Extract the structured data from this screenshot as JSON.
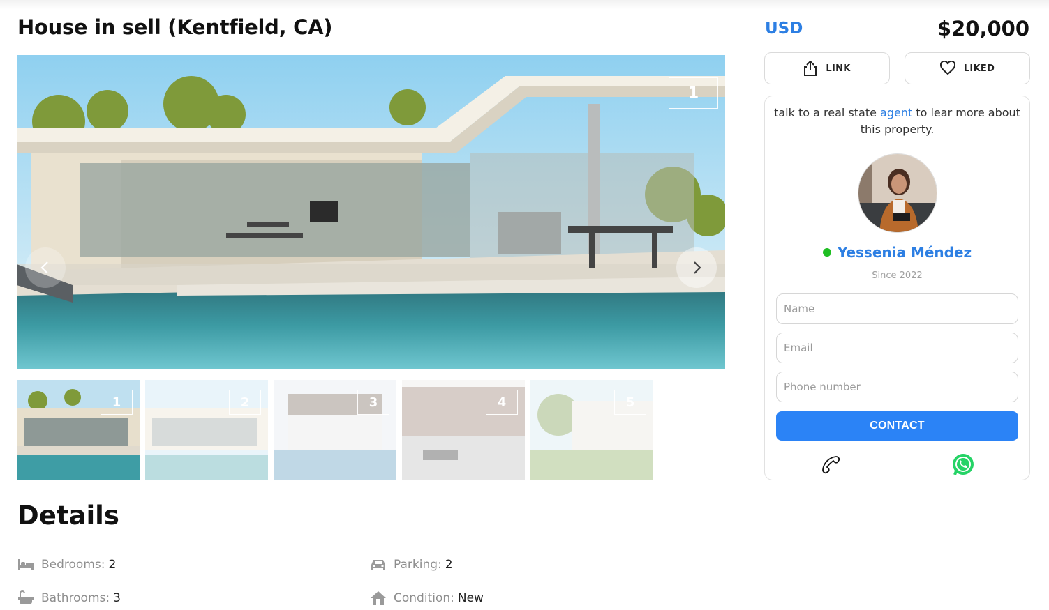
{
  "listing": {
    "title": "House in sell (Kentfield, CA)",
    "currency": "USD",
    "price": "$20,000"
  },
  "gallery": {
    "current": "1",
    "thumbnails": [
      "1",
      "2",
      "3",
      "4",
      "5"
    ]
  },
  "actions": {
    "link_label": "LINK",
    "liked_label": "LIKED"
  },
  "agent": {
    "intro_before": "talk to a real state ",
    "intro_link": "agent",
    "intro_after": " to lear more about this property.",
    "name": "Yessenia Méndez",
    "since": "Since 2022",
    "status_color": "#1fbe23"
  },
  "form": {
    "name_placeholder": "Name",
    "email_placeholder": "Email",
    "phone_placeholder": "Phone number",
    "contact_label": "CONTACT"
  },
  "details": {
    "title": "Details",
    "bedrooms_label": "Bedrooms:",
    "bedrooms": "2",
    "bathrooms_label": "Bathrooms:",
    "bathrooms": "3",
    "parking_label": "Parking:",
    "parking": "2",
    "condition_label": "Condition:",
    "condition": "New"
  },
  "icons": [
    "share-icon",
    "heart-icon",
    "phone-icon",
    "whatsapp-icon",
    "bed-icon",
    "bathtub-icon",
    "car-icon",
    "house-icon",
    "chevron-left-icon",
    "chevron-right-icon"
  ],
  "colors": {
    "accent": "#2d7fe3",
    "contact_button": "#2b83f6",
    "whatsapp": "#25d366"
  }
}
